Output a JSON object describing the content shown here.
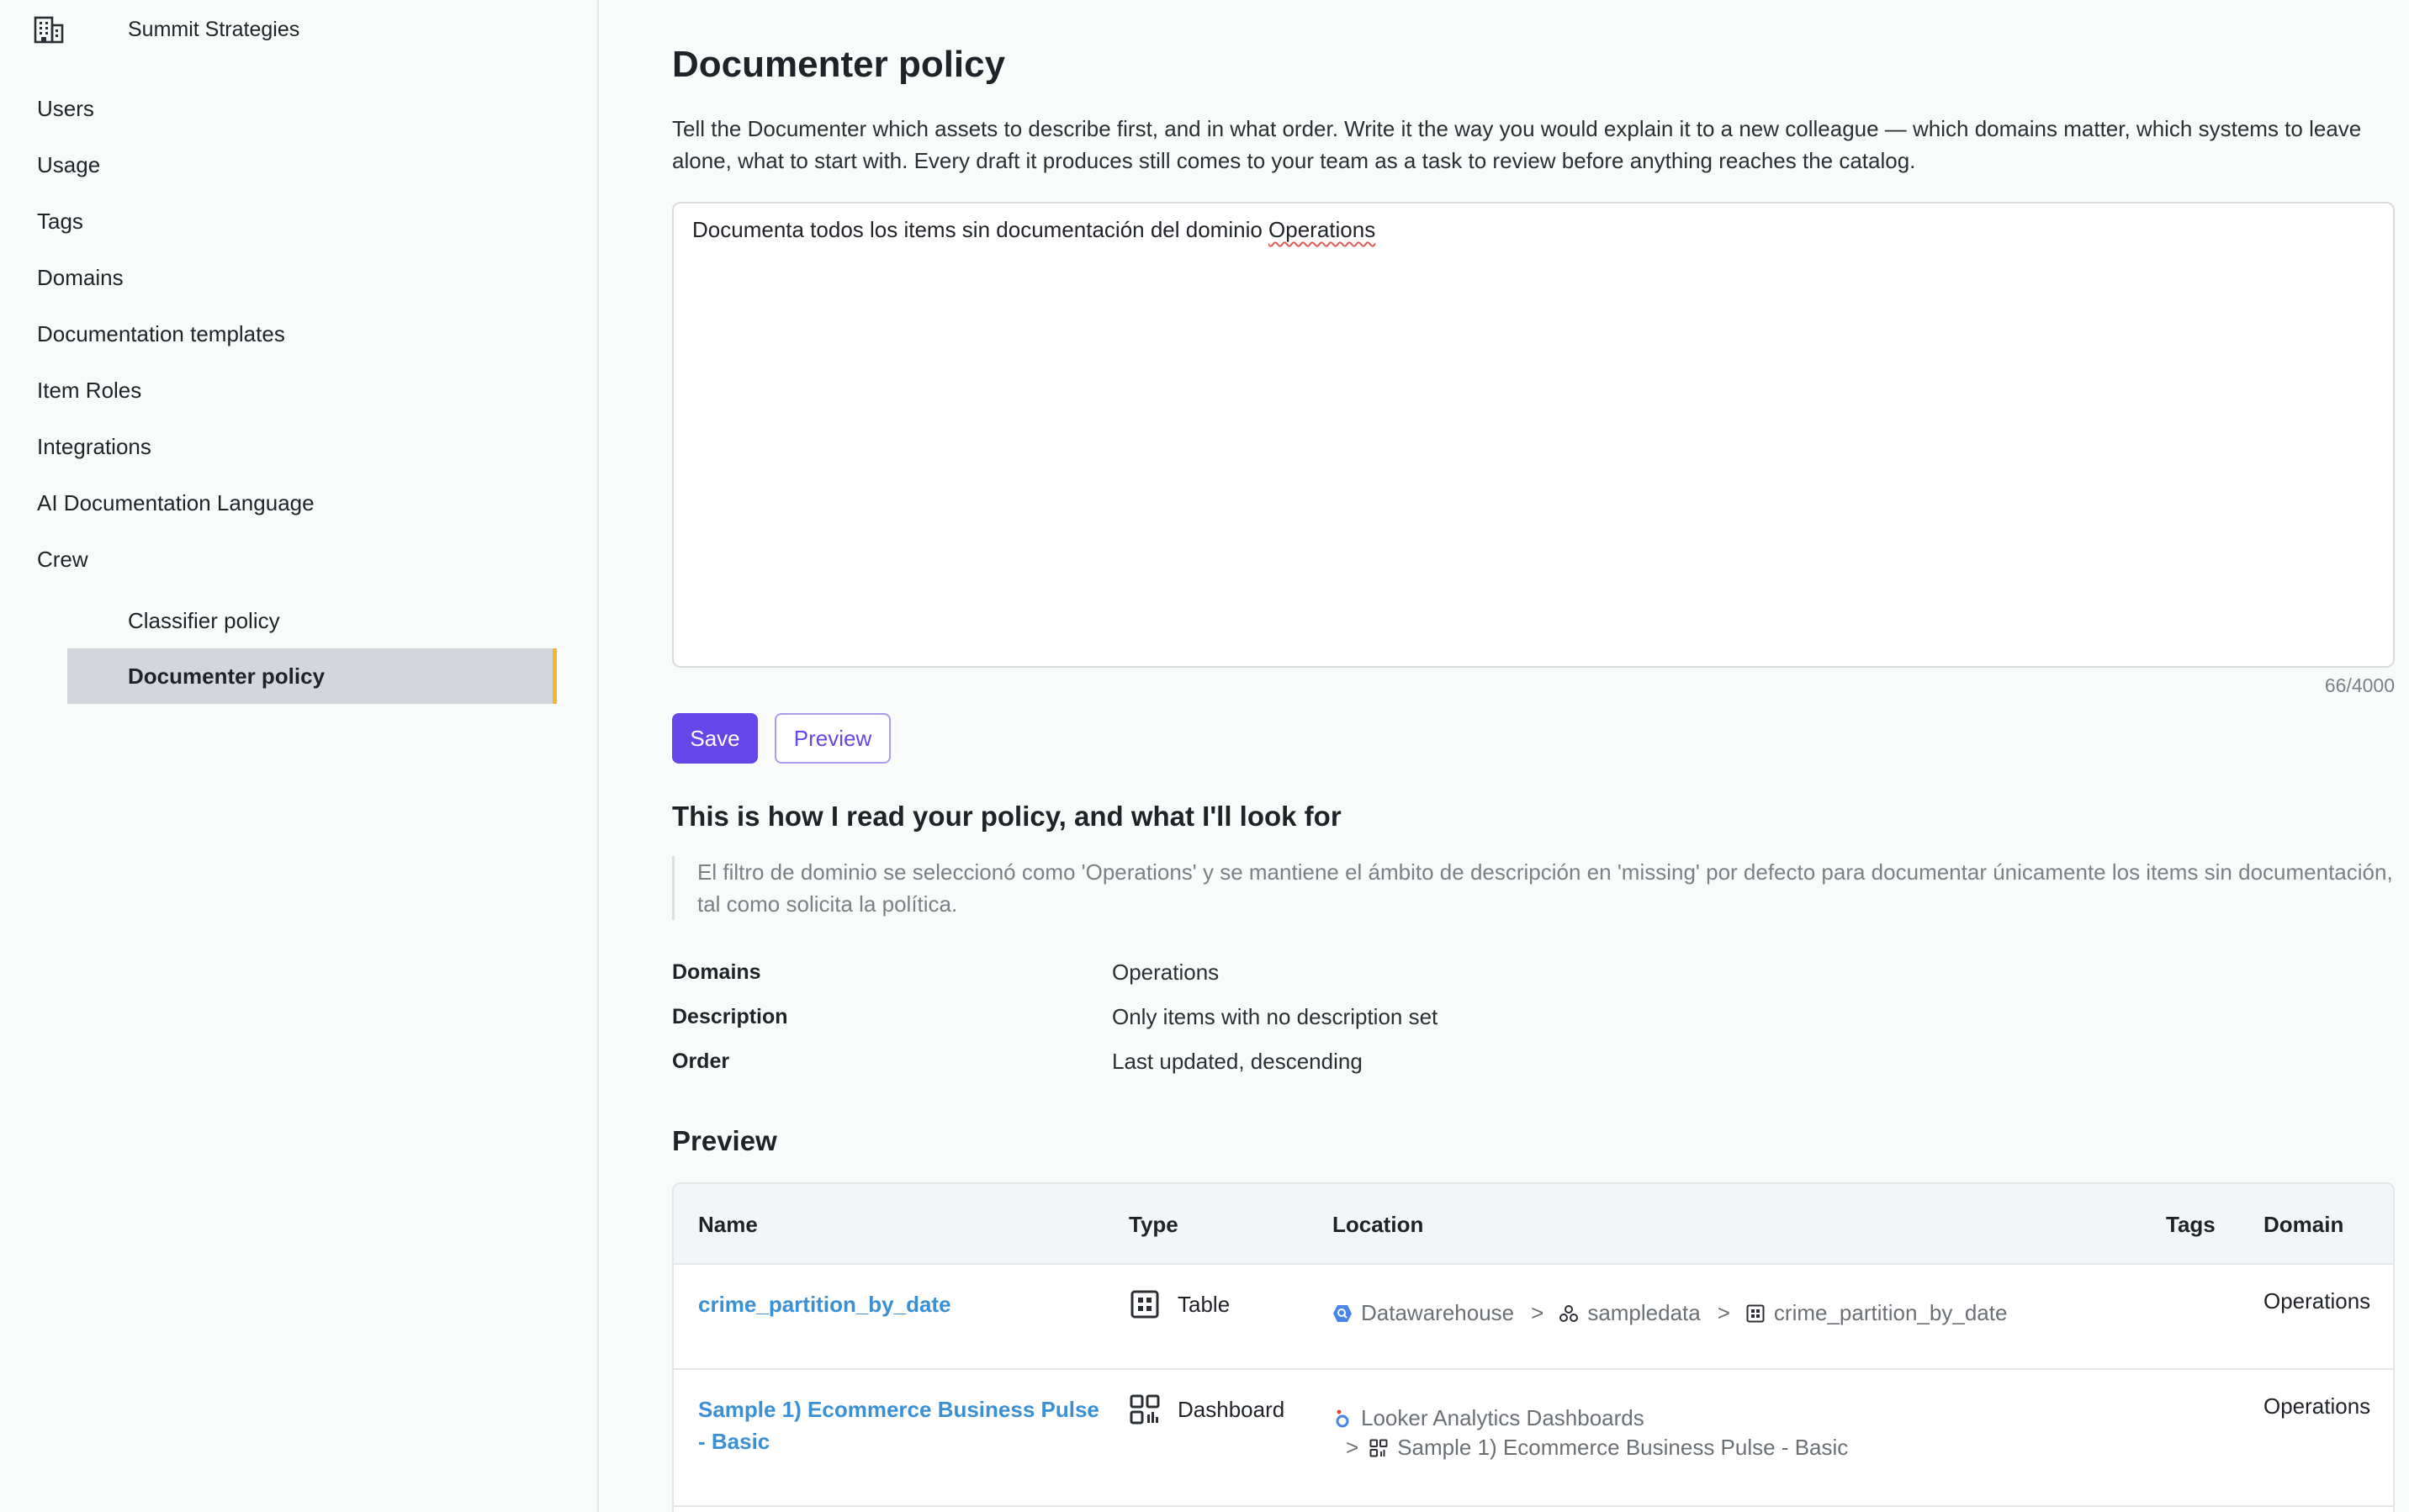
{
  "sidebar": {
    "org_icon": "building-icon",
    "org_name": "Summit Strategies",
    "items": [
      {
        "label": "Users"
      },
      {
        "label": "Usage"
      },
      {
        "label": "Tags"
      },
      {
        "label": "Domains"
      },
      {
        "label": "Documentation templates"
      },
      {
        "label": "Item Roles"
      },
      {
        "label": "Integrations"
      },
      {
        "label": "AI Documentation Language"
      },
      {
        "label": "Crew"
      }
    ],
    "subitems": [
      {
        "label": "Classifier policy"
      },
      {
        "label": "Documenter policy"
      }
    ],
    "active_subitem": "Documenter policy",
    "active_accent": "#f3b832"
  },
  "main": {
    "title": "Documenter policy",
    "intro": "Tell the Documenter which assets to describe first, and in what order. Write it the way you would explain it to a new colleague — which domains matter, which systems to leave alone, what to start with. Every draft it produces still comes to your team as a task to review before anything reaches the catalog.",
    "policy": {
      "text_before": "Documenta todos los items sin documentación del dominio ",
      "text_flagged": "Operations",
      "counter": "66/4000"
    },
    "buttons": {
      "save": "Save",
      "preview": "Preview",
      "primary_color": "#6546e8"
    },
    "interpretation": {
      "title": "This is how I read your policy, and what I'll look for",
      "explanation": "El filtro de dominio se seleccionó como 'Operations' y se mantiene el ámbito de descripción en 'missing' por defecto para documentar únicamente los items sin documentación, tal como solicita la política.",
      "rows": [
        {
          "key": "Domains",
          "value": "Operations"
        },
        {
          "key": "Description",
          "value": "Only items with no description set"
        },
        {
          "key": "Order",
          "value": "Last updated, descending"
        }
      ]
    },
    "preview": {
      "title": "Preview",
      "columns": {
        "name": "Name",
        "type": "Type",
        "location": "Location",
        "tags": "Tags",
        "domain": "Domain"
      },
      "rows": [
        {
          "name": "crime_partition_by_date",
          "type": "Table",
          "type_icon": "table-icon",
          "location": [
            "Datawarehouse",
            "sampledata",
            "crime_partition_by_date"
          ],
          "location_icons": [
            "bigquery-icon",
            "dataset-icon",
            "table-icon"
          ],
          "separator": ">",
          "tags": "",
          "domain": "Operations"
        },
        {
          "name": "Sample 1) Ecommerce Business Pulse - Basic",
          "type": "Dashboard",
          "type_icon": "dashboard-icon",
          "location": [
            "Looker Analytics Dashboards",
            "Sample 1) Ecommerce Business Pulse - Basic"
          ],
          "location_icons": [
            "looker-icon",
            "dashboard-icon"
          ],
          "separator": ">",
          "tags": "",
          "domain": "Operations"
        }
      ]
    }
  }
}
